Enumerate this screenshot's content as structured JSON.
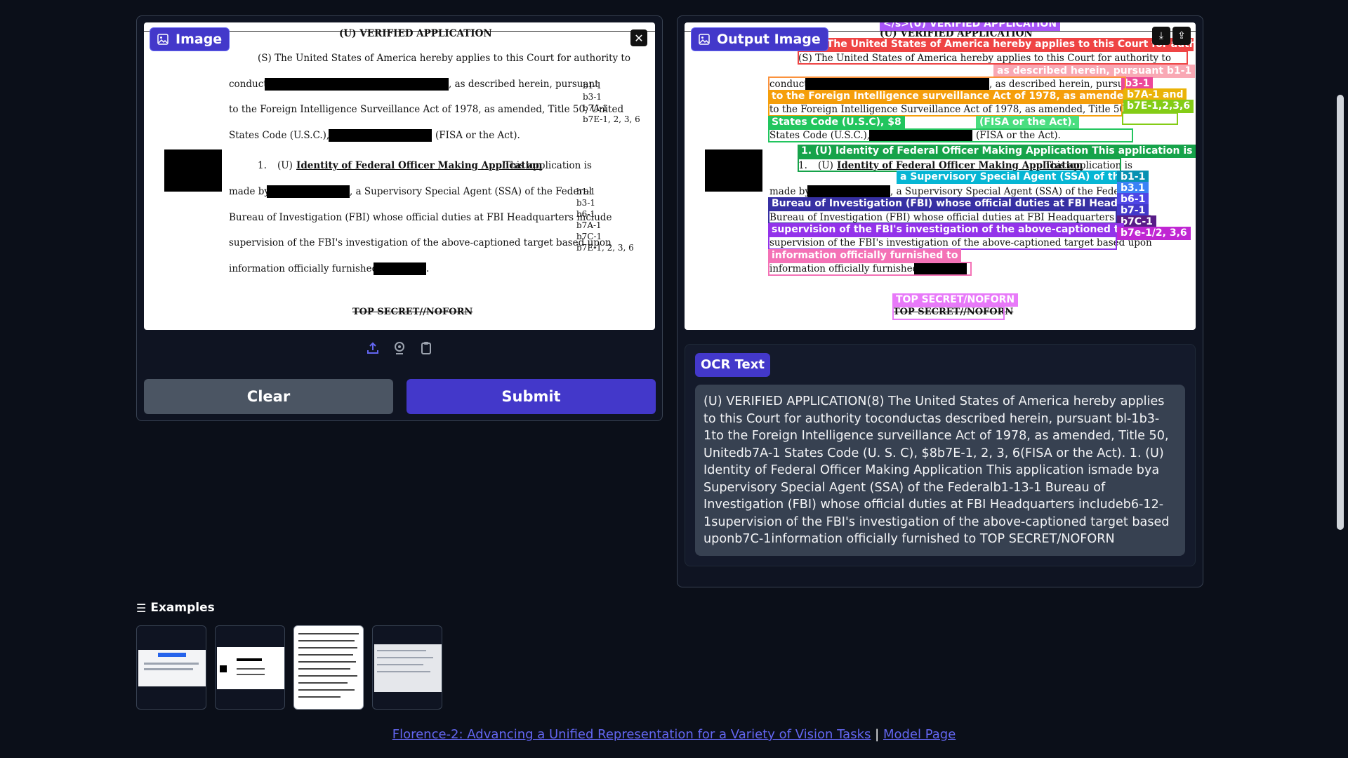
{
  "input_panel": {
    "label": "Image",
    "close_icon": "close-icon"
  },
  "document": {
    "heading": "(U)  VERIFIED APPLICATION",
    "line1": "(S)  The United States of America hereby applies to this Court for authority to",
    "line2a": "conduct",
    "line2b": ", as described herein, pursuant",
    "line3": "to the Foreign Intelligence Surveillance Act of 1978, as amended, Title 50, United",
    "line4a": "States Code (U.S.C.), §§",
    "line4b": "(FISA or the Act).",
    "item_num": "1.",
    "item_u": "(U)",
    "item_title": "Identity of Federal Officer Making Application",
    "item_rest": "This application is",
    "line6a": "made by",
    "line6b": ", a Supervisory Special Agent (SSA) of the Federal",
    "line7": "Bureau of Investigation (FBI) whose official duties at FBI Headquarters include",
    "line8": "supervision of the FBI's investigation of the above-captioned target based upon",
    "line9": "information officially furnished to",
    "footer": "TOP SECRET//NOFORN",
    "side1": [
      "b1-1",
      "b3-1",
      "b7A-1",
      "b7E-1, 2, 3, 6"
    ],
    "side2": [
      "b1-1",
      "b3-1",
      "b6-1",
      "b7A-1",
      "b7C-1",
      "b7E-1, 2, 3, 6"
    ]
  },
  "toolbar": {
    "upload_icon": "upload-icon",
    "webcam_icon": "webcam-icon",
    "clipboard_icon": "clipboard-icon"
  },
  "buttons": {
    "clear": "Clear",
    "submit": "Submit"
  },
  "output_panel": {
    "label": "Output Image",
    "download_icon": "download-icon",
    "share_icon": "share-icon",
    "box_labels": {
      "verified": "</s>(U) VERIFIED APPLICATION",
      "s_united": "(S) The United States of America hereby applies to this Court for authority to",
      "as_described": "as described herein, pursuant b1-1",
      "b3": "b3-1",
      "fisa_line": "to the Foreign Intelligence surveillance Act of 1978, as amended, Title 50, United",
      "b7a": "b7A-1 and",
      "b7e": "b7E-1,2,3,6",
      "states_code": "States Code (U.S.C), $8",
      "fisa_act": "(FISA or the Act).",
      "identity": "1. (U) Identity of Federal Officer Making Application This application is",
      "ssa": "a Supervisory Special Agent (SSA) of the Federal",
      "b1": "b1-1",
      "b31": "b3.1",
      "bureau": "Bureau of Investigation (FBI) whose official duties at FBI Headquarters include",
      "b6": "b6-1",
      "b7": "b7-1",
      "b7c": "b7C-1",
      "supervision": "supervision of the FBI's investigation of the above-captioned target based upon",
      "b7e2": "b7e-1/2, 3,6",
      "info": "information officially furnished to",
      "topsecret": "TOP SECRET/NOFORN"
    }
  },
  "ocr": {
    "label": "OCR Text",
    "text": "(U) VERIFIED APPLICATION(8) The United States of America hereby applies to this Court for authority toconductas described herein, pursuant bl-1b3-1to the Foreign Intelligence surveillance Act of 1978, as amended, Title 50, Unitedb7A-1 States Code (U. S. C), $8b7E-1, 2, 3, 6(FISA or the Act). 1. (U) Identity of Federal Officer Making Application This application ismade bya Supervisory Special Agent (SSA) of the Federalb1-13-1 Bureau of Investigation (FBI) whose official duties at FBI Headquarters includeb6-12-1supervision of the FBI's investigation of the above-captioned target based uponb7C-1information officially furnished to TOP SECRET/NOFORN"
  },
  "examples": {
    "title": "Examples",
    "list_icon": "list-icon"
  },
  "footer": {
    "link1": "Florence-2: Advancing a Unified Representation for a Variety of Vision Tasks",
    "separator": "|",
    "link2": "Model Page"
  },
  "colors": {
    "background": "#0b0f19",
    "accent": "#4338ca",
    "panel_border": "#374151"
  }
}
